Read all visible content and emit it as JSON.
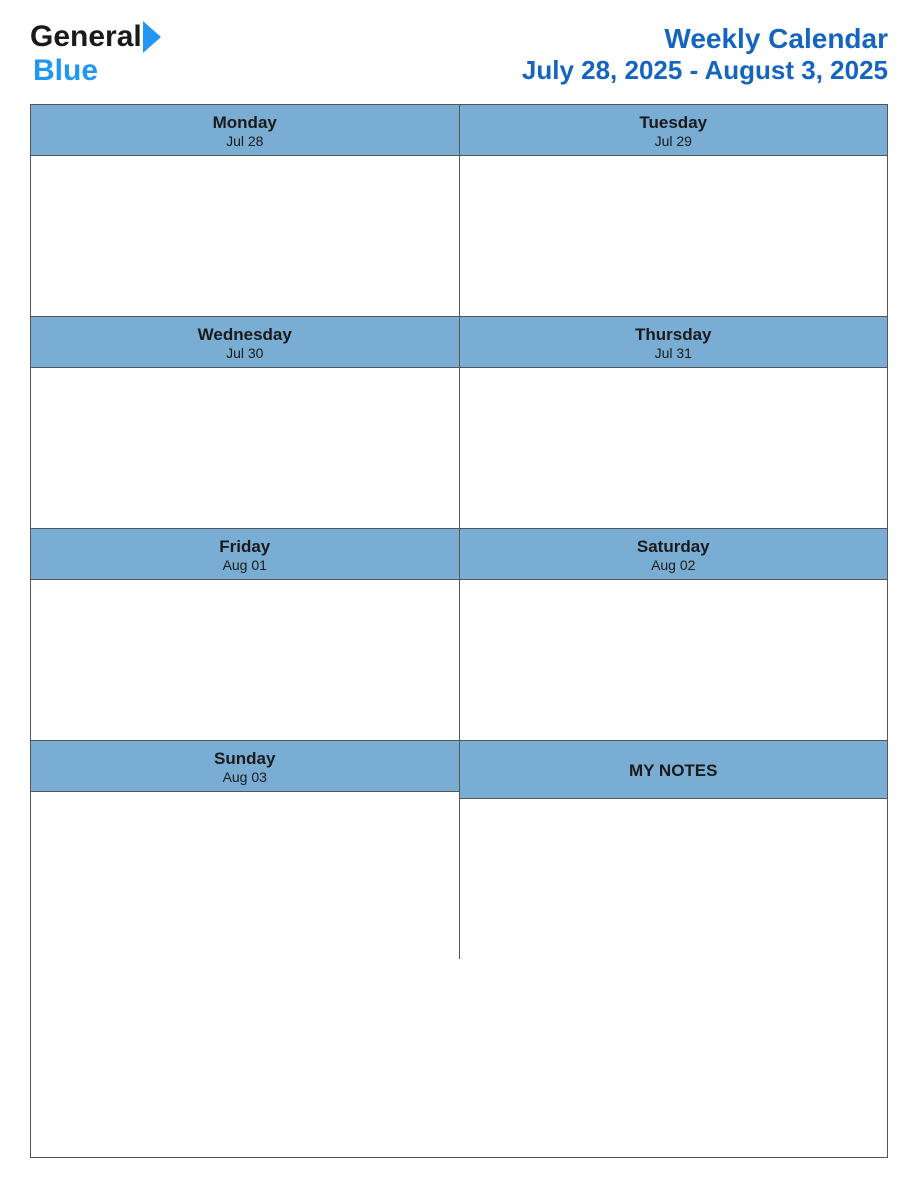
{
  "header": {
    "logo": {
      "general_text": "General",
      "blue_text": "Blue"
    },
    "title": "Weekly Calendar",
    "date_range": "July 28, 2025 - August 3, 2025"
  },
  "calendar": {
    "rows": [
      {
        "cells": [
          {
            "day_name": "Monday",
            "day_date": "Jul 28",
            "type": "day"
          },
          {
            "day_name": "Tuesday",
            "day_date": "Jul 29",
            "type": "day"
          }
        ]
      },
      {
        "cells": [
          {
            "day_name": "Wednesday",
            "day_date": "Jul 30",
            "type": "day"
          },
          {
            "day_name": "Thursday",
            "day_date": "Jul 31",
            "type": "day"
          }
        ]
      },
      {
        "cells": [
          {
            "day_name": "Friday",
            "day_date": "Aug 01",
            "type": "day"
          },
          {
            "day_name": "Saturday",
            "day_date": "Aug 02",
            "type": "day"
          }
        ]
      },
      {
        "cells": [
          {
            "day_name": "Sunday",
            "day_date": "Aug 03",
            "type": "day"
          },
          {
            "day_name": "MY NOTES",
            "type": "notes"
          }
        ]
      }
    ]
  }
}
